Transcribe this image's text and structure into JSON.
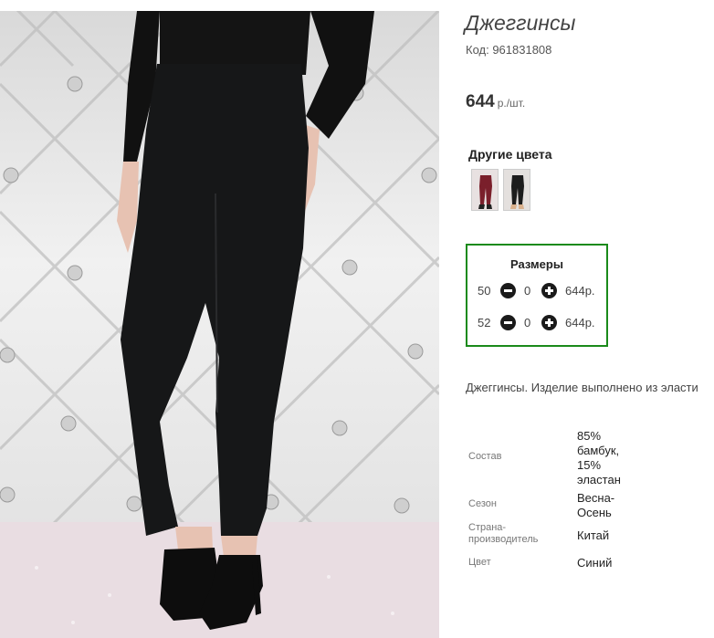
{
  "product": {
    "title": "Джеггинсы",
    "code": "Код: 961831808",
    "price": "644",
    "price_unit": "р./шт."
  },
  "other_colors": {
    "label": "Другие цвета",
    "swatches": [
      {
        "color": "#7a1f2b",
        "icon": "burgundy-jeggings-thumbnail"
      },
      {
        "color": "#1c1c1c",
        "icon": "black-jeggings-thumbnail"
      }
    ]
  },
  "sizes": {
    "title": "Размеры",
    "rows": [
      {
        "size": "50",
        "qty": "0",
        "price": "644р."
      },
      {
        "size": "52",
        "qty": "0",
        "price": "644р."
      }
    ]
  },
  "description": "Джеггинсы. Изделие выполнено из эласти",
  "specs": [
    {
      "key": "Состав",
      "value": "85% бамбук, 15% эластан"
    },
    {
      "key": "Сезон",
      "value": "Весна-Осень"
    },
    {
      "key": "Страна-производитель",
      "value": "Китай"
    },
    {
      "key": "Цвет",
      "value": "Синий"
    }
  ],
  "colors": {
    "accent_border": "#1a8a1a",
    "button": "#1a1a1a"
  }
}
